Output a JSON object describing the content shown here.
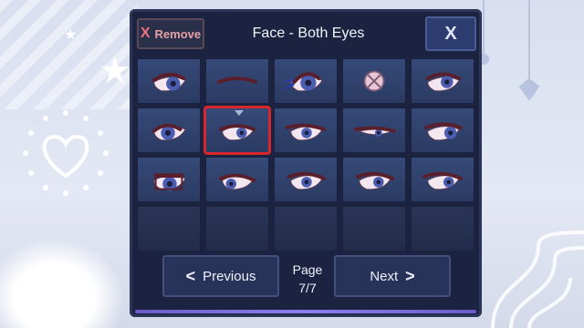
{
  "header": {
    "remove_icon": "X",
    "remove_label": "Remove",
    "title": "Face - Both Eyes",
    "close_icon": "X"
  },
  "grid": {
    "rows": 4,
    "cols": 5,
    "selected_index": 6,
    "items": [
      {
        "icon": "eye-style-1"
      },
      {
        "icon": "eye-style-2"
      },
      {
        "icon": "eye-style-3"
      },
      {
        "icon": "eye-style-4-crossed"
      },
      {
        "icon": "eye-style-5"
      },
      {
        "icon": "eye-style-6"
      },
      {
        "icon": "eye-style-7"
      },
      {
        "icon": "eye-style-8"
      },
      {
        "icon": "eye-style-9"
      },
      {
        "icon": "eye-style-10"
      },
      {
        "icon": "eye-style-11"
      },
      {
        "icon": "eye-style-12"
      },
      {
        "icon": "eye-style-13"
      },
      {
        "icon": "eye-style-14"
      },
      {
        "icon": "eye-style-15"
      },
      {
        "icon": "empty"
      },
      {
        "icon": "empty"
      },
      {
        "icon": "empty"
      },
      {
        "icon": "empty"
      },
      {
        "icon": "empty"
      }
    ]
  },
  "footer": {
    "previous_label": "Previous",
    "next_label": "Next",
    "page_label": "Page",
    "page_value": "7/7"
  },
  "colors": {
    "panel": "#1b2340",
    "cell": "#364a78",
    "selection": "#d8262e",
    "remove_text": "#e9a0a6"
  }
}
